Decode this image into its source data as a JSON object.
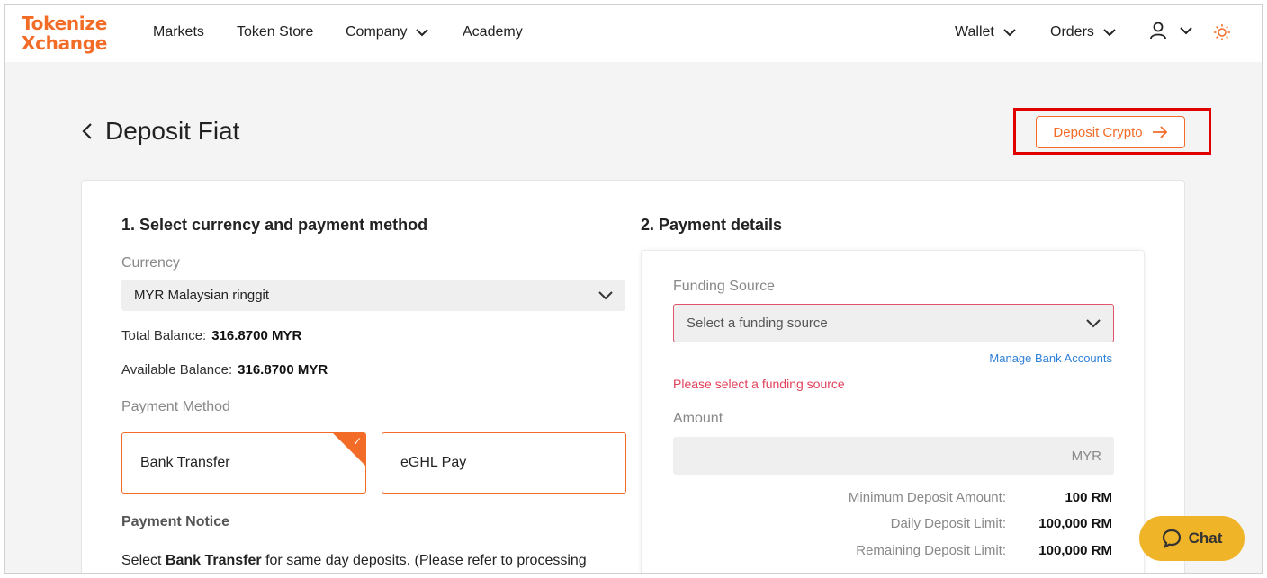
{
  "logo": {
    "line1": "Tokenize",
    "line2": "Xchange"
  },
  "nav": {
    "markets": "Markets",
    "token_store": "Token Store",
    "company": "Company",
    "academy": "Academy",
    "wallet": "Wallet",
    "orders": "Orders"
  },
  "page": {
    "title": "Deposit Fiat",
    "deposit_crypto": "Deposit Crypto"
  },
  "section1": {
    "title": "1. Select currency and payment method",
    "currency_label": "Currency",
    "currency_value": "MYR Malaysian ringgit",
    "total_balance_label": "Total Balance:",
    "total_balance_value": "316.8700 MYR",
    "available_balance_label": "Available Balance:",
    "available_balance_value": "316.8700 MYR",
    "payment_method_label": "Payment Method",
    "methods": [
      "Bank Transfer",
      "eGHL Pay"
    ],
    "selected_method": "Bank Transfer",
    "notice_title": "Payment Notice",
    "notice_pre": "Select ",
    "notice_bold": "Bank Transfer",
    "notice_post": " for same day deposits. (Please refer to processing"
  },
  "section2": {
    "title": "2. Payment details",
    "funding_label": "Funding Source",
    "funding_placeholder": "Select a funding source",
    "manage_link": "Manage Bank Accounts",
    "error": "Please select a funding source",
    "amount_label": "Amount",
    "amount_unit": "MYR",
    "limits": [
      {
        "label": "Minimum Deposit Amount:",
        "value": "100 RM"
      },
      {
        "label": "Daily Deposit Limit:",
        "value": "100,000 RM"
      },
      {
        "label": "Remaining Deposit Limit:",
        "value": "100,000 RM"
      }
    ]
  },
  "chat": {
    "label": "Chat"
  },
  "colors": {
    "accent": "#f26c28",
    "error": "#e0405a",
    "link": "#2f80d8",
    "chat": "#f0b429"
  }
}
